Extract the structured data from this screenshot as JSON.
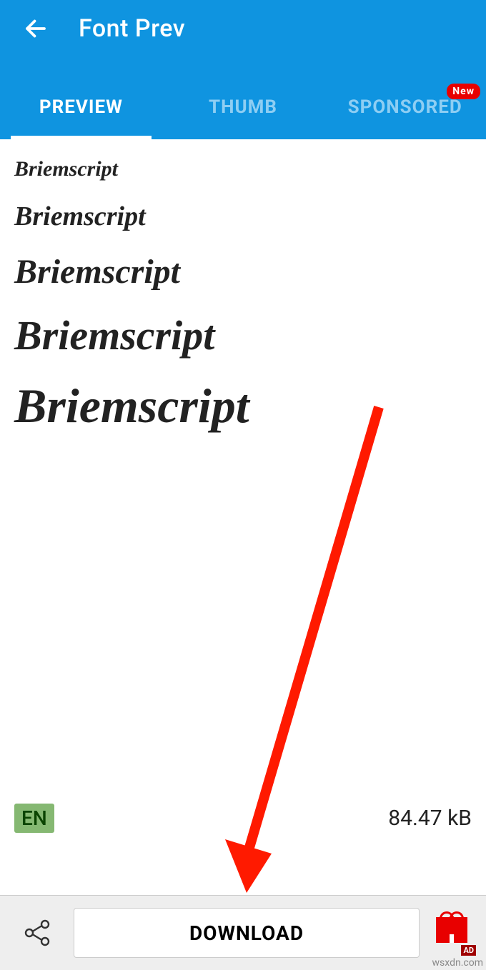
{
  "header": {
    "title": "Font Prev"
  },
  "tabs": {
    "preview": "PREVIEW",
    "thumb": "THUMB",
    "sponsored": "SPONSORED",
    "badge_new": "New"
  },
  "preview": {
    "lines": [
      "Briemscript",
      "Briemscript",
      "Briemscript",
      "Briemscript",
      "Briemscript"
    ]
  },
  "meta": {
    "lang": "EN",
    "size": "84.47 kB"
  },
  "bottom": {
    "download": "DOWNLOAD",
    "ad_label": "AD"
  },
  "watermark": "wsxdn.com"
}
